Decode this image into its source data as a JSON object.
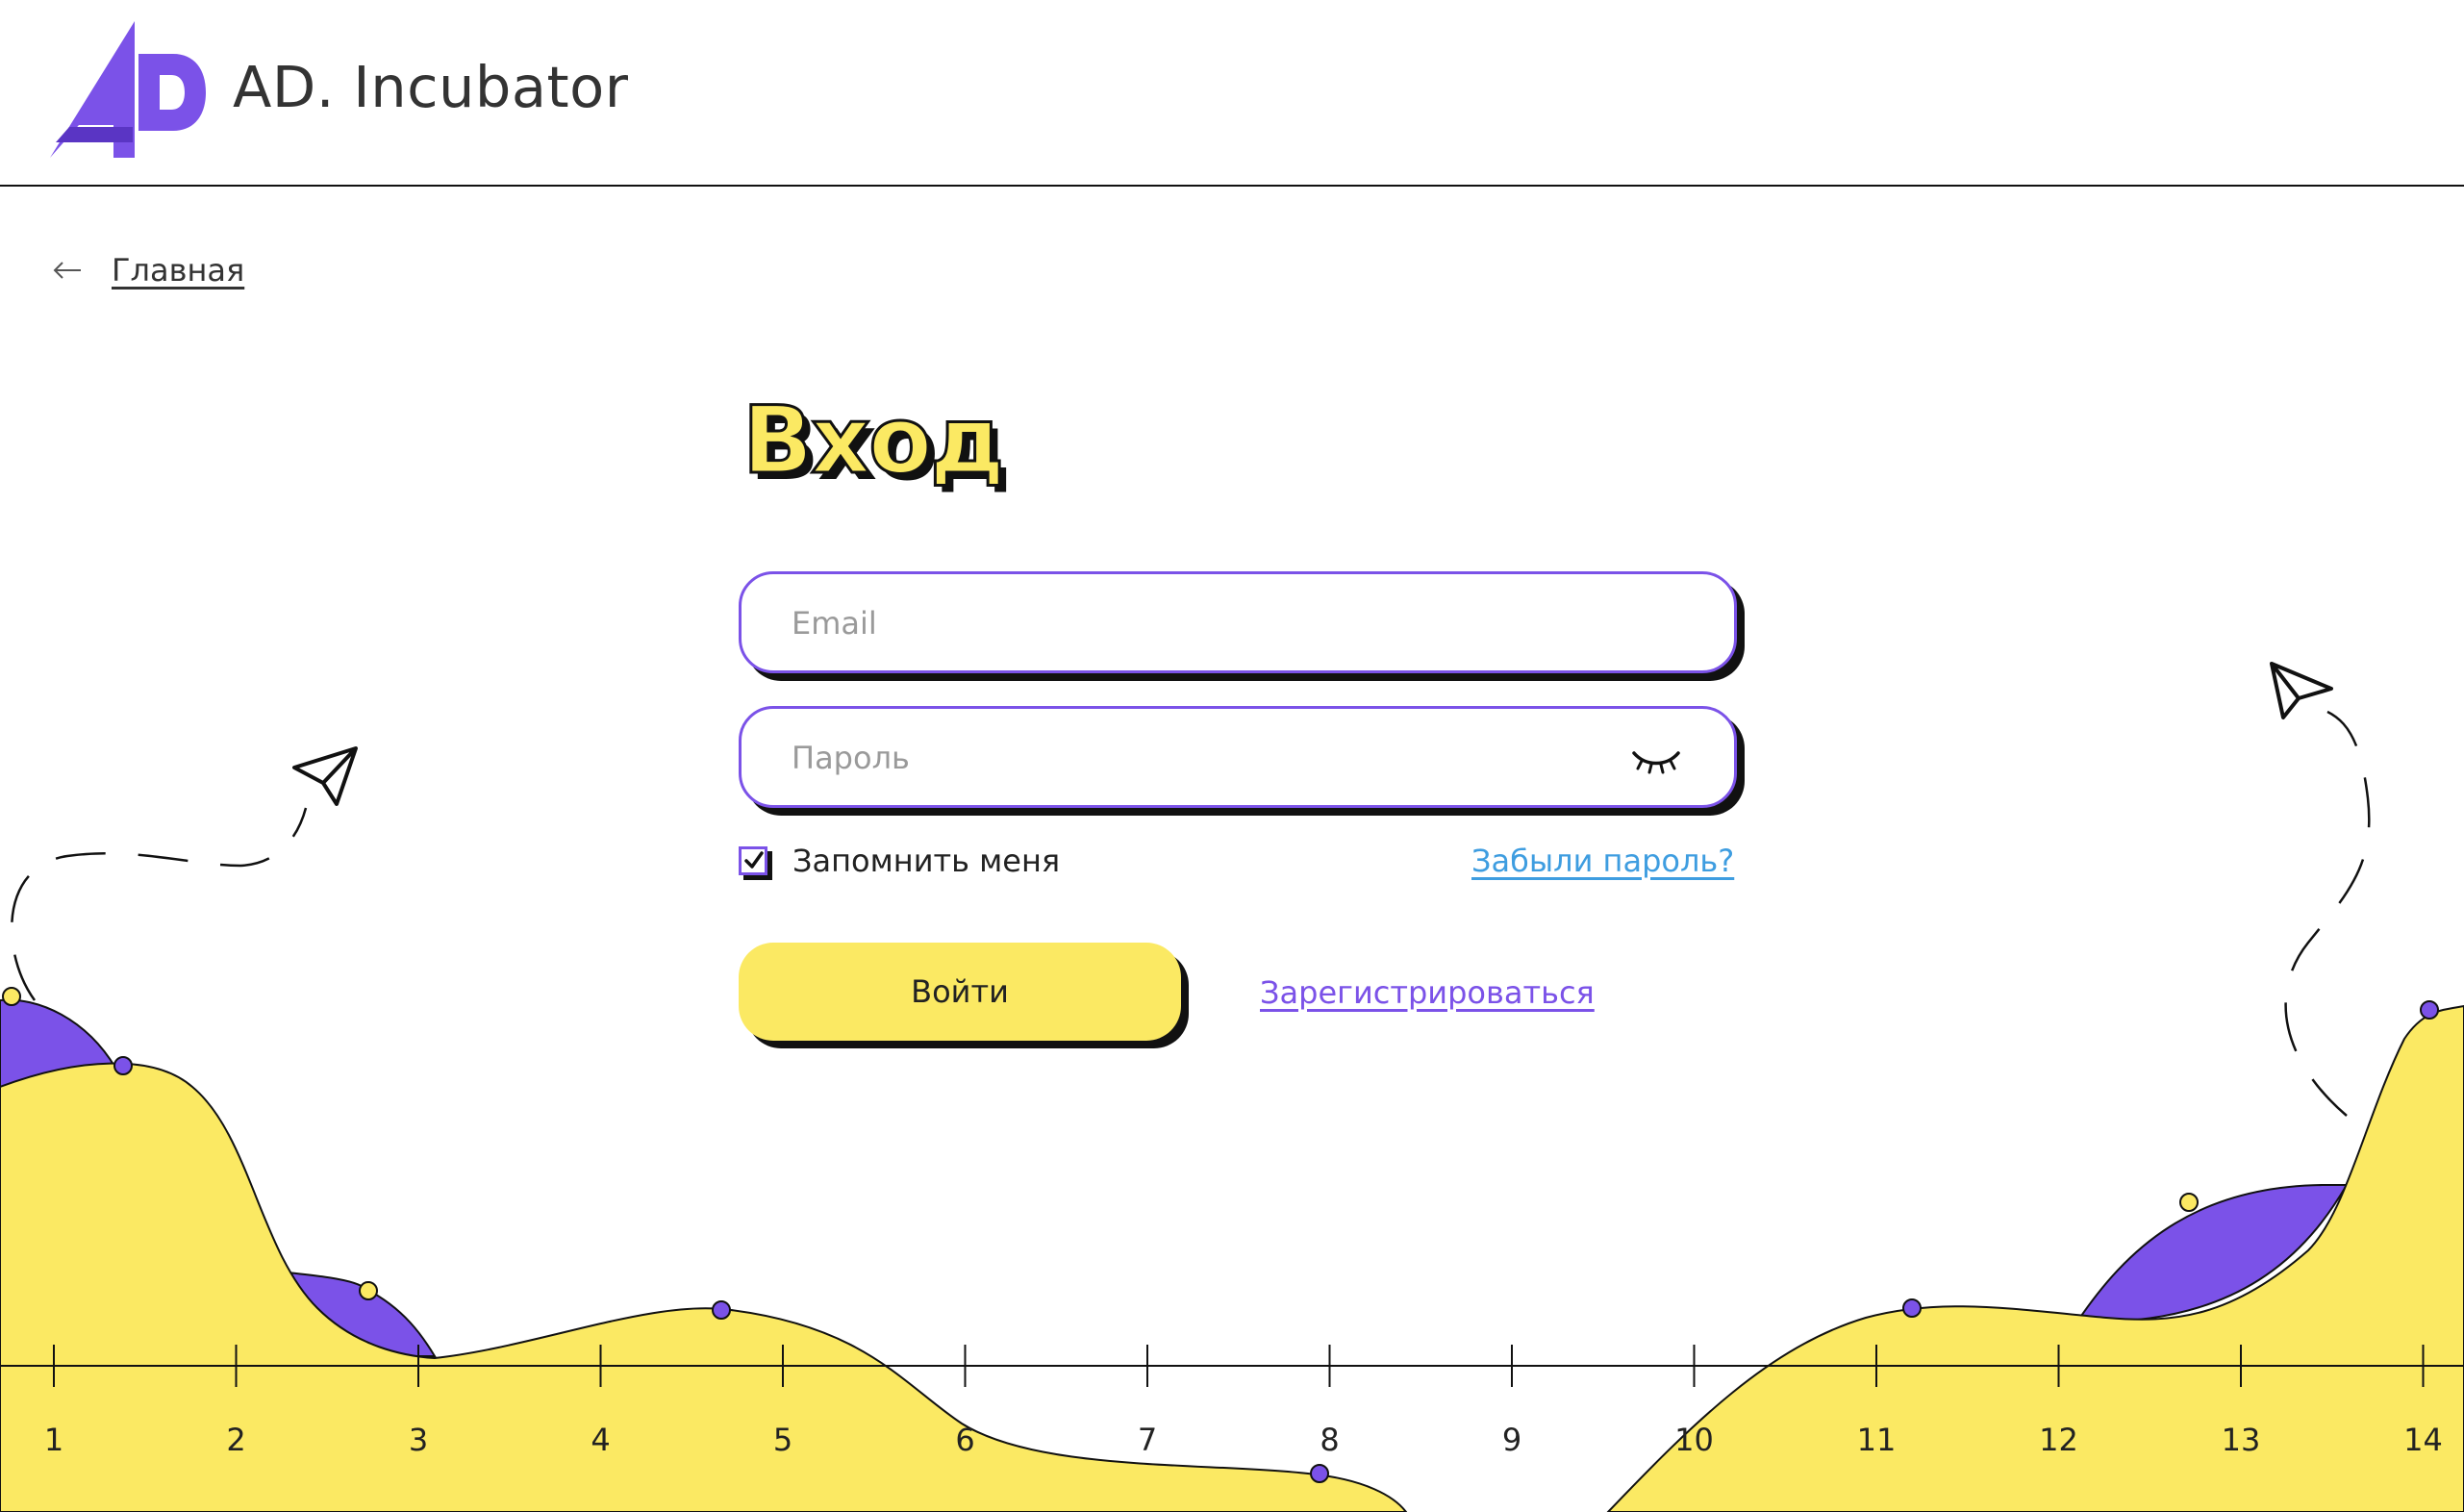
{
  "header": {
    "brand": "AD. Incubator",
    "logo_icon": "ad-logo-icon"
  },
  "breadcrumb": {
    "back_icon": "arrow-left-icon",
    "label": "Главная"
  },
  "login": {
    "title": "Вход",
    "email": {
      "placeholder": "Email",
      "value": ""
    },
    "password": {
      "placeholder": "Пароль",
      "value": "",
      "toggle_icon": "eye-closed-icon"
    },
    "remember": {
      "label": "Запомнить меня",
      "checked": true
    },
    "forgot_label": "Забыли пароль?",
    "submit_label": "Войти",
    "register_label": "Зарегистрироваться"
  },
  "axis": {
    "ticks": [
      "1",
      "2",
      "3",
      "4",
      "5",
      "6",
      "7",
      "8",
      "9",
      "10",
      "11",
      "12",
      "13",
      "14"
    ]
  },
  "colors": {
    "accent": "#7b52e8",
    "yellow": "#fbe963",
    "link_blue": "#3e9de0",
    "text": "#222222"
  }
}
